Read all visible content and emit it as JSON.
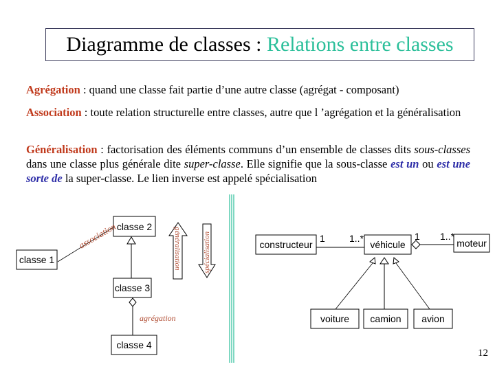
{
  "title": {
    "main": "Diagramme de classes : ",
    "accent": "Relations entre classes"
  },
  "definitions": {
    "aggregation": {
      "term": "Agrégation",
      "text": " : quand une classe fait partie d’une autre classe (agrégat - composant)"
    },
    "association": {
      "term": "Association",
      "text": " : toute relation structurelle entre classes, autre que l ’agrégation et la généralisation"
    },
    "generalisation": {
      "term": "Généralisation",
      "text1": " : factorisation des éléments communs d’un ensemble de classes dits ",
      "it1": "sous-classes",
      "text2": " dans une classe plus générale dite ",
      "it2": "super-classe",
      "text3": ". Elle signifie que la sous-classe ",
      "em1": "est un",
      "text4": " ou ",
      "em2": "est une sorte de",
      "text5": " la super-classe. Le lien inverse est appelé spécialisation"
    }
  },
  "diagram_left": {
    "classes": [
      "classe 1",
      "classe 2",
      "classe 3",
      "classe 4"
    ],
    "labels": {
      "association": "association",
      "aggregation": "agrégation",
      "generalisation": "généralisation",
      "specialisation": "spécialisation"
    }
  },
  "diagram_right": {
    "classes": {
      "constructeur": "constructeur",
      "vehicule": "véhicule",
      "moteur": "moteur",
      "voiture": "voiture",
      "camion": "camion",
      "avion": "avion"
    },
    "multiplicities": {
      "constructeur_end": "1",
      "vehicule_end_left": "1..*",
      "vehicule_end_right": "1",
      "moteur_end": "1..*"
    }
  },
  "colors": {
    "accent": "#2bbf9a",
    "keyword": "#c0391b",
    "emphasis": "#2e2ea8",
    "label": "#b04a30"
  },
  "page_number": "12"
}
